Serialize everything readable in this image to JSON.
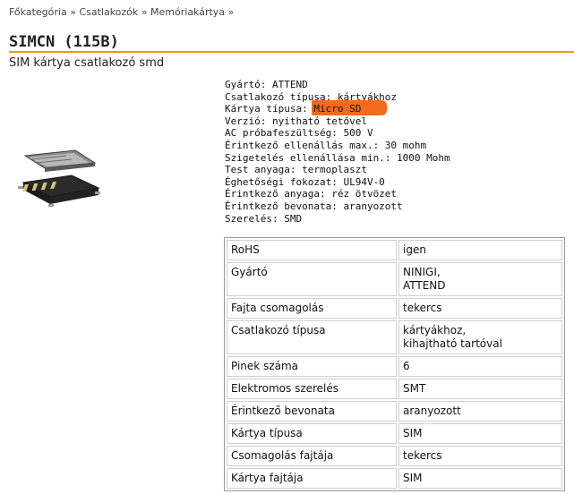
{
  "breadcrumb": {
    "items": [
      "Főkategória",
      "Csatlakozók",
      "Memóriakártya"
    ],
    "separator": "»"
  },
  "product": {
    "title": "SIMCN (115B)",
    "subtitle": "SIM kártya csatlakozó smd",
    "image_icon": "sim-card-connector-photo"
  },
  "specs": [
    "Gyártó: ATTEND",
    "Csatlakozó típusa: kártyákhoz",
    "Kártya típusa: ",
    "Verzió: nyitható tetővel",
    "AC próbafeszültség: 500 V",
    "Érintkező ellenállás max.: 30 mohm",
    "Szigetelés ellenállása min.: 1000 Mohm",
    "Test anyaga: termoplaszt",
    "Éghetőségi fokozat: UL94V-0",
    "Érintkező anyaga: réz ötvözet",
    "Érintkező bevonata: aranyozott",
    "Szerelés: SMD"
  ],
  "highlight": {
    "text": "Micro SD",
    "color": "#f26a1b"
  },
  "properties": {
    "rows": [
      {
        "key": "RoHS",
        "value": [
          "igen"
        ]
      },
      {
        "key": "Gyártó",
        "value": [
          "NINIGI,",
          "ATTEND"
        ]
      },
      {
        "key": "Fajta csomagolás",
        "value": [
          "tekercs"
        ]
      },
      {
        "key": "Csatlakozó típusa",
        "value": [
          "kártyákhoz,",
          "kihajtható tartóval"
        ]
      },
      {
        "key": "Pinek száma",
        "value": [
          "6"
        ]
      },
      {
        "key": "Elektromos szerelés",
        "value": [
          "SMT"
        ]
      },
      {
        "key": "Érintkező bevonata",
        "value": [
          "aranyozott"
        ]
      },
      {
        "key": "Kártya típusa",
        "value": [
          "SIM"
        ]
      },
      {
        "key": "Csomagolás fajtája",
        "value": [
          "tekercs"
        ]
      },
      {
        "key": "Kártya fajtája",
        "value": [
          "SIM"
        ]
      }
    ]
  },
  "colors": {
    "accent_rule": "#e8961e",
    "highlight": "#f26a1b"
  }
}
